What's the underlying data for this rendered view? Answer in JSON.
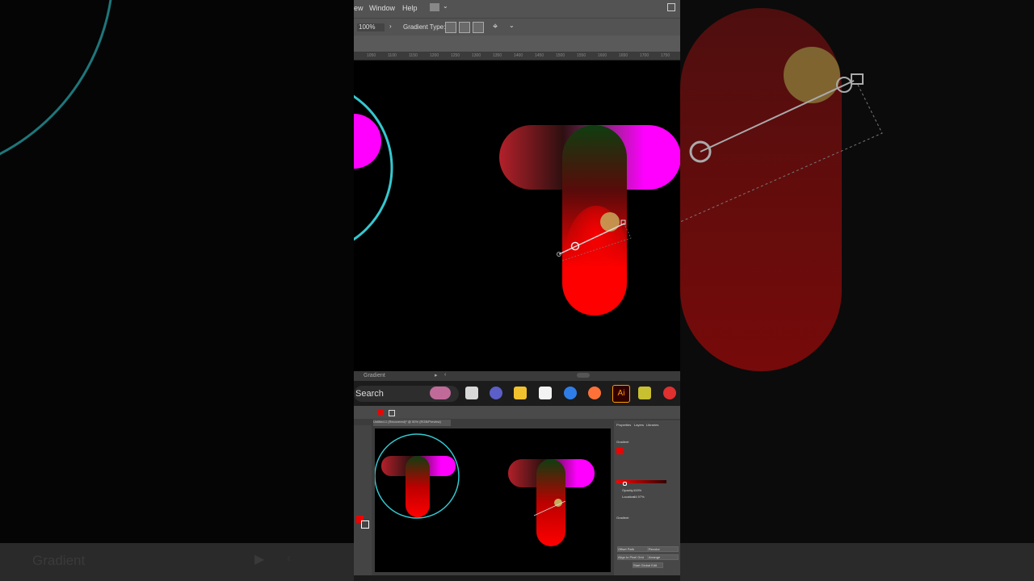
{
  "app": {
    "menu": [
      "ew",
      "Window",
      "Help"
    ],
    "zoom": "100%",
    "gradient_type_label": "Gradient Type:",
    "ruler_ticks": [
      "1050",
      "1100",
      "1150",
      "1200",
      "1250",
      "1300",
      "1350",
      "1400",
      "1450",
      "1500",
      "1550",
      "1600",
      "1650",
      "1700",
      "1750"
    ]
  },
  "gradient_panel": {
    "title": "Gradient",
    "blurred_title": "Gradient"
  },
  "taskbar": {
    "search_placeholder": "Search"
  },
  "mini_app": {
    "tab_title": "Untitled-1 (Recovered)* @ 50% (RGB/Preview)",
    "panel_tabs": [
      "Properties",
      "Layers",
      "Libraries"
    ],
    "panel_section": "Gradient",
    "opacity_label": "Opacity:",
    "opacity_value": "100%",
    "location_label": "Location:",
    "location_value": "44.97%",
    "quick_actions": [
      "Offset Path",
      "Recolor",
      "Align to Pixel Grid",
      "Arrange",
      "Start Global Edit"
    ]
  },
  "colors": {
    "accent_magenta": "#ff00ff",
    "accent_red": "#ff0000",
    "accent_green": "#0f3d10",
    "circle_cyan": "#35c8d0",
    "ui_gray": "#535353"
  }
}
